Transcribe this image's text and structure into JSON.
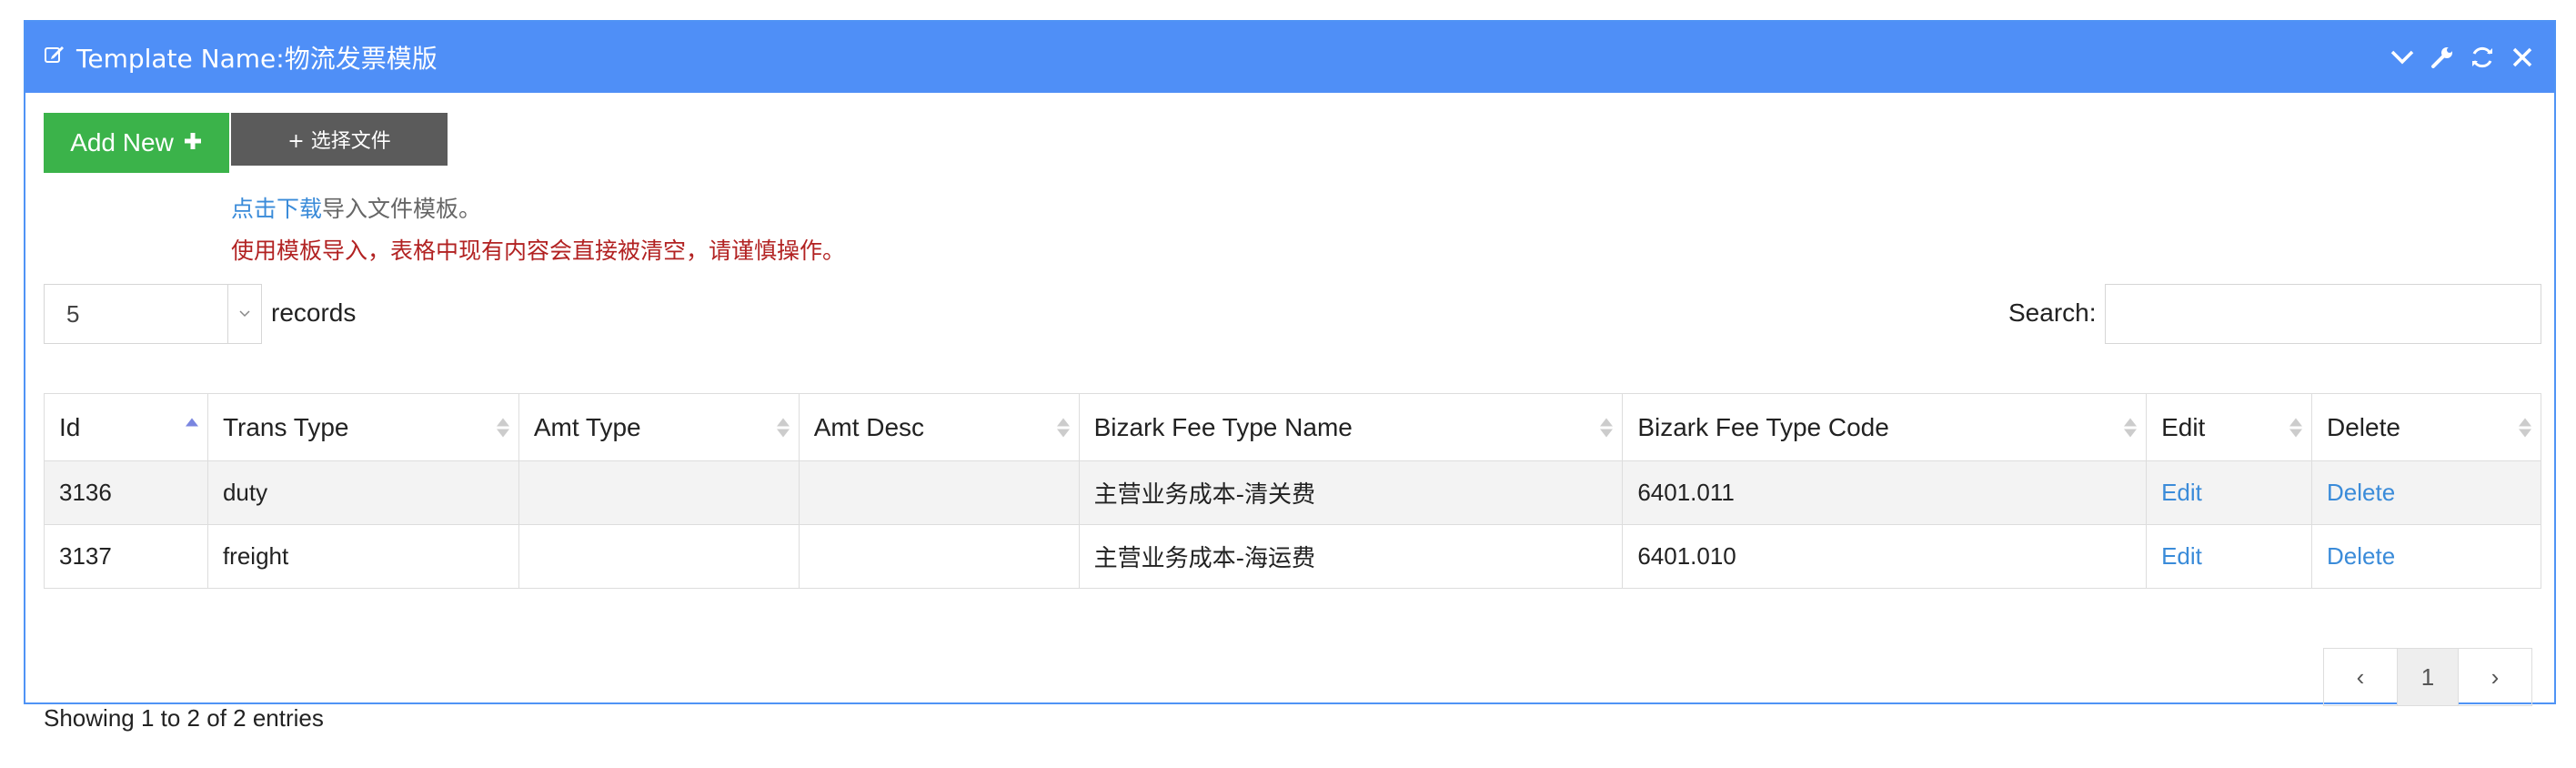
{
  "header": {
    "title": "Template Name:物流发票模版",
    "colors": {
      "bar": "#4f8ff7",
      "border": "#4f93f5"
    },
    "tools": [
      "chevron-down-icon",
      "wrench-icon",
      "refresh-icon",
      "close-icon"
    ]
  },
  "toolbar": {
    "add_label": "Add New",
    "file_label": "+ 选择文件",
    "hint_link": "点击下载",
    "hint_rest": "导入文件模板。",
    "warning": "使用模板导入，表格中现有内容会直接被清空，请谨慎操作。"
  },
  "length": {
    "value": "5",
    "label": "records"
  },
  "search": {
    "label": "Search:",
    "value": "",
    "placeholder": ""
  },
  "table": {
    "columns": [
      "Id",
      "Trans Type",
      "Amt Type",
      "Amt Desc",
      "Bizark Fee Type Name",
      "Bizark Fee Type Code",
      "Edit",
      "Delete"
    ],
    "rows": [
      {
        "id": "3136",
        "trans_type": "duty",
        "amt_type": "",
        "amt_desc": "",
        "fee_name": "主营业务成本-清关费",
        "fee_code": "6401.011",
        "edit": "Edit",
        "delete": "Delete"
      },
      {
        "id": "3137",
        "trans_type": "freight",
        "amt_type": "",
        "amt_desc": "",
        "fee_name": "主营业务成本-海运费",
        "fee_code": "6401.010",
        "edit": "Edit",
        "delete": "Delete"
      }
    ]
  },
  "info": "Showing 1 to 2 of 2 entries",
  "pagination": {
    "prev": "‹",
    "current": "1",
    "next": "›"
  }
}
